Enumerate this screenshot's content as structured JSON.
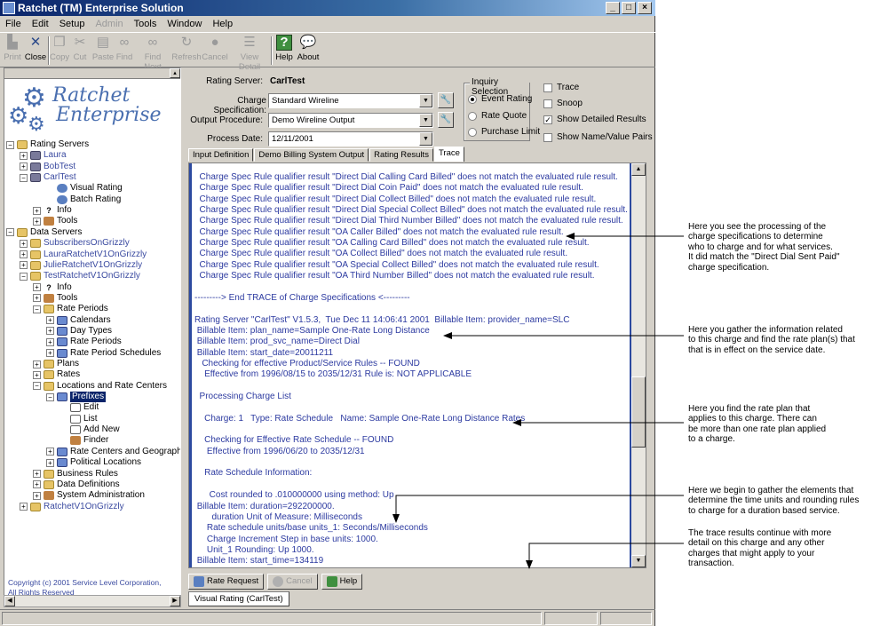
{
  "window": {
    "title": "Ratchet (TM) Enterprise Solution",
    "controls": {
      "minimize": "_",
      "maximize": "□",
      "close": "×"
    }
  },
  "menu": [
    "File",
    "Edit",
    "Setup",
    "Admin",
    "Tools",
    "Window",
    "Help"
  ],
  "toolbar": [
    {
      "label": "Print",
      "icon": "printer-icon",
      "enabled": false
    },
    {
      "label": "Close",
      "icon": "close-doc-icon",
      "enabled": true
    },
    {
      "label": "Copy",
      "icon": "copy-icon",
      "enabled": false
    },
    {
      "label": "Cut",
      "icon": "cut-icon",
      "enabled": false
    },
    {
      "label": "Paste",
      "icon": "paste-icon",
      "enabled": false
    },
    {
      "label": "Find",
      "icon": "binoculars-icon",
      "enabled": false
    },
    {
      "label": "Find Next",
      "icon": "binoculars-next-icon",
      "enabled": false
    },
    {
      "label": "Refresh",
      "icon": "refresh-icon",
      "enabled": false
    },
    {
      "label": "Cancel",
      "icon": "stop-icon",
      "enabled": false
    },
    {
      "label": "View Detail",
      "icon": "detail-icon",
      "enabled": false
    },
    {
      "label": "Help",
      "icon": "help-icon",
      "enabled": true
    },
    {
      "label": "About",
      "icon": "about-icon",
      "enabled": true
    }
  ],
  "logo": {
    "line1": "Ratchet",
    "line2": "Enterprise"
  },
  "tree": [
    {
      "label": "Rating Servers",
      "icon": "folder",
      "blue": false
    },
    {
      "label": "Laura",
      "icon": "server",
      "blue": true
    },
    {
      "label": "BobTest",
      "icon": "server",
      "blue": true
    },
    {
      "label": "CarlTest",
      "icon": "server",
      "blue": true
    },
    {
      "label": "Visual Rating",
      "icon": "gear",
      "blue": false
    },
    {
      "label": "Batch Rating",
      "icon": "gear",
      "blue": false
    },
    {
      "label": "Info",
      "icon": "info",
      "blue": false
    },
    {
      "label": "Tools",
      "icon": "tools",
      "blue": false
    },
    {
      "label": "Data Servers",
      "icon": "folder",
      "blue": false
    },
    {
      "label": "SubscribersOnGrizzly",
      "icon": "folder",
      "blue": true
    },
    {
      "label": "LauraRatchetV1OnGrizzly",
      "icon": "folder",
      "blue": true
    },
    {
      "label": "JulieRatchetV1OnGrizzly",
      "icon": "folder",
      "blue": true
    },
    {
      "label": "TestRatchetV1OnGrizzly",
      "icon": "folder",
      "blue": true
    },
    {
      "label": "Info",
      "icon": "info",
      "blue": false
    },
    {
      "label": "Tools",
      "icon": "tools",
      "blue": false
    },
    {
      "label": "Rate Periods",
      "icon": "folder",
      "blue": false
    },
    {
      "label": "Calendars",
      "icon": "list",
      "blue": false
    },
    {
      "label": "Day Types",
      "icon": "list",
      "blue": false
    },
    {
      "label": "Rate Periods",
      "icon": "list",
      "blue": false
    },
    {
      "label": "Rate Period Schedules",
      "icon": "list",
      "blue": false
    },
    {
      "label": "Plans",
      "icon": "folder",
      "blue": false
    },
    {
      "label": "Rates",
      "icon": "folder",
      "blue": false
    },
    {
      "label": "Locations and Rate Centers",
      "icon": "folder",
      "blue": false
    },
    {
      "label": "Prefixes",
      "icon": "list",
      "blue": false
    },
    {
      "label": "Edit",
      "icon": "doc",
      "blue": false
    },
    {
      "label": "List",
      "icon": "doc",
      "blue": false
    },
    {
      "label": "Add New",
      "icon": "doc",
      "blue": false
    },
    {
      "label": "Finder",
      "icon": "binoculars",
      "blue": false
    },
    {
      "label": "Rate Centers and Geographic Lo",
      "icon": "list",
      "blue": false
    },
    {
      "label": "Political Locations",
      "icon": "list",
      "blue": false
    },
    {
      "label": "Business Rules",
      "icon": "folder",
      "blue": false
    },
    {
      "label": "Data Definitions",
      "icon": "folder",
      "blue": false
    },
    {
      "label": "System Administration",
      "icon": "tools",
      "blue": false
    },
    {
      "label": "RatchetV1OnGrizzly",
      "icon": "folder",
      "blue": true
    }
  ],
  "copyright": {
    "line1": "Copyright (c) 2001 Service Level Corporation,",
    "line2": "All Rights Reserved"
  },
  "form": {
    "rating_server_label": "Rating Server:",
    "rating_server_value": "CarlTest",
    "charge_spec_label": "Charge Specification:",
    "charge_spec_value": "Standard Wireline",
    "output_proc_label": "Output Procedure:",
    "output_proc_value": "Demo Wireline Output",
    "process_date_label": "Process Date:",
    "process_date_value": "12/11/2001"
  },
  "inquiry": {
    "title": "Inquiry Selection",
    "options": [
      "Event Rating",
      "Rate Quote",
      "Purchase Limit"
    ],
    "selected": "Event Rating"
  },
  "checks": [
    {
      "label": "Trace",
      "checked": false
    },
    {
      "label": "Snoop",
      "checked": false
    },
    {
      "label": "Show Detailed Results",
      "checked": true
    },
    {
      "label": "Show Name/Value Pairs",
      "checked": false
    }
  ],
  "tabs": [
    "Input Definition",
    "Demo Billing System Output",
    "Rating Results",
    "Trace"
  ],
  "active_tab": "Trace",
  "trace_lines": [
    "  Charge Spec Rule qualifier result \"Direct Dial Calling Card Billed\" does not match the evaluated rule result.",
    "  Charge Spec Rule qualifier result \"Direct Dial Coin Paid\" does not match the evaluated rule result.",
    "  Charge Spec Rule qualifier result \"Direct Dial Collect Billed\" does not match the evaluated rule result.",
    "  Charge Spec Rule qualifier result \"Direct Dial Special Collect Billed\" does not match the evaluated rule result.",
    "  Charge Spec Rule qualifier result \"Direct Dial Third Number Billed\" does not match the evaluated rule result.",
    "  Charge Spec Rule qualifier result \"OA Caller Billed\" does not match the evaluated rule result.",
    "  Charge Spec Rule qualifier result \"OA Calling Card Billed\" does not match the evaluated rule result.",
    "  Charge Spec Rule qualifier result \"OA Collect Billed\" does not match the evaluated rule result.",
    "  Charge Spec Rule qualifier result \"OA Special Collect Billed\" does not match the evaluated rule result.",
    "  Charge Spec Rule qualifier result \"OA Third Number Billed\" does not match the evaluated rule result.",
    "",
    "---------> End TRACE of Charge Specifications <---------",
    "",
    "Rating Server \"CarlTest\" V1.5.3,  Tue Dec 11 14:06:41 2001  Billable Item: provider_name=SLC",
    " Billable Item: plan_name=Sample One-Rate Long Distance",
    " Billable Item: prod_svc_name=Direct Dial",
    " Billable Item: start_date=20011211",
    "   Checking for effective Product/Service Rules -- FOUND",
    "    Effective from 1996/08/15 to 2035/12/31 Rule is: NOT APPLICABLE",
    "",
    "  Processing Charge List",
    "",
    "    Charge: 1   Type: Rate Schedule   Name: Sample One-Rate Long Distance Rates",
    "",
    "    Checking for Effective Rate Schedule -- FOUND",
    "     Effective from 1996/06/20 to 2035/12/31",
    "",
    "    Rate Schedule Information:",
    "",
    "      Cost rounded to .010000000 using method: Up",
    " Billable Item: duration=292200000.",
    "       duration Unit of Measure: Milliseconds",
    "     Rate schedule units/base units_1: Seconds/Milliseconds",
    "     Charge Increment Step in base units: 1000.",
    "     Unit_1 Rounding: Up 1000.",
    " Billable Item: start_time=134119"
  ],
  "bottom_buttons": [
    {
      "label": "Rate Request",
      "enabled": true
    },
    {
      "label": "Cancel",
      "enabled": false
    },
    {
      "label": "Help",
      "enabled": true
    }
  ],
  "doc_tab": "Visual Rating (CarlTest)",
  "annotations": [
    [
      "Here you see the processing of the",
      "charge specifications to determine",
      "who to charge and for what services.",
      "It did match the \"Direct Dial Sent Paid\"",
      "charge specification."
    ],
    [
      "Here you gather the information related",
      "to this charge and find the rate plan(s) that",
      "that is in effect on the service date."
    ],
    [
      "Here you find the rate plan that",
      "applies to this charge. There can",
      "be more than one rate plan applied",
      "to a charge."
    ],
    [
      "Here we begin to gather the elements that",
      "determine the time units and rounding rules",
      "to charge for a duration based service."
    ],
    [
      "The trace results continue with more",
      "detail on this charge and any other",
      "charges that might apply to your",
      "transaction."
    ]
  ]
}
